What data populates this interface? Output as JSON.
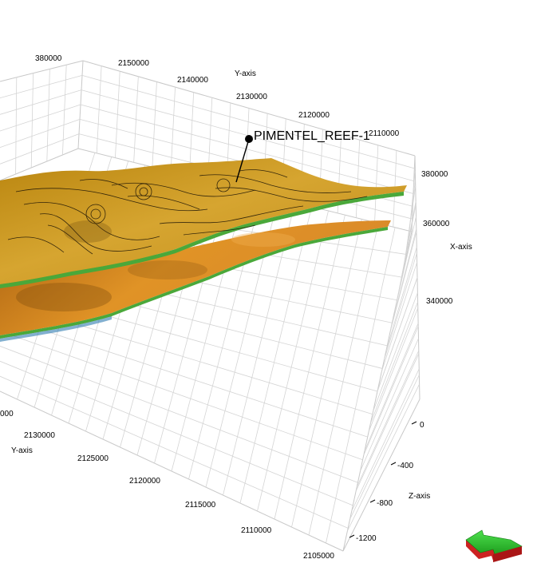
{
  "scene": {
    "well": {
      "name": "PIMENTEL_REEF-1"
    },
    "axes": {
      "y_axis_label": "Y-axis",
      "x_axis_label": "X-axis",
      "z_axis_label": "Z-axis",
      "top_y_ticks": [
        "2150000",
        "2140000",
        "2130000",
        "2120000",
        "2110000"
      ],
      "bottom_y_ticks": [
        "2130000",
        "2125000",
        "2120000",
        "2115000",
        "2110000",
        "2105000"
      ],
      "x_ticks": [
        "380000",
        "360000",
        "340000"
      ],
      "top_left_x_tick": "380000",
      "z_ticks": [
        "0",
        "-400",
        "-800",
        "-1200"
      ],
      "left_edge_partial": "000"
    },
    "colors": {
      "surface_top": "#c8951a",
      "surface_shadow": "#8a5a10",
      "surface_lower": "#d98a1e",
      "edge_green": "#4aa83a",
      "grid_line": "#c8c8c8",
      "orient_green": "#33cc33",
      "orient_red": "#cc2222"
    },
    "widgets": {
      "orientation_icon": "orientation-arrow-icon"
    }
  }
}
